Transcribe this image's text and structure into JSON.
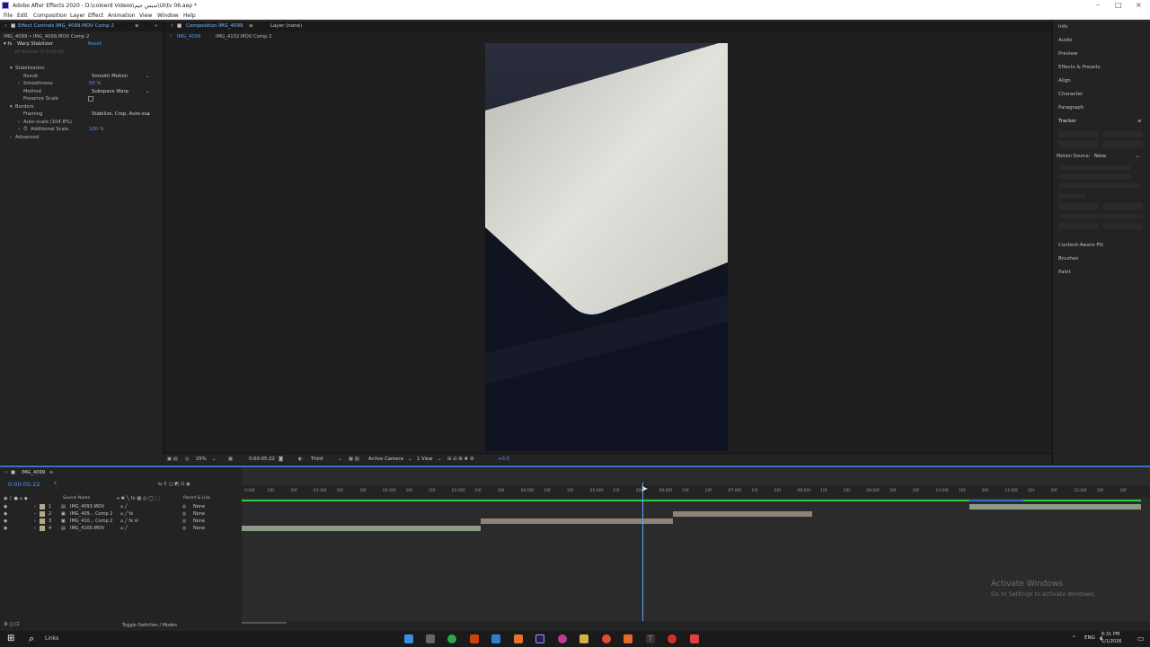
{
  "window": {
    "title": "Adobe After Effects 2020 - D:\\coloerd Videos\\سیس‌ جیم\\UI\\tv 06.aep *"
  },
  "menu": [
    "File",
    "Edit",
    "Composition",
    "Layer",
    "Effect",
    "Animation",
    "View",
    "Window",
    "Help"
  ],
  "effect_controls": {
    "tab_label": "Effect Controls IMG_4099.MOV Comp 2",
    "breadcrumb": "IMG_4099 • IMG_4099.MOV Comp 2",
    "effect_name": "Warp Stabilizer",
    "reset_label": "Reset",
    "dim_status": "All frames in 0.00.00",
    "stabilization_label": "Stabilization",
    "result_label": "Result",
    "result_value": "Smooth Motion",
    "smoothness_label": "Smoothness",
    "smoothness_value": "50 %",
    "method_label": "Method",
    "method_value": "Subspace Warp",
    "preserve_scale_label": "Preserve Scale",
    "borders_label": "Borders",
    "framing_label": "Framing",
    "framing_value": "Stabilize, Crop, Auto-sca",
    "autoscale_label": "Auto-scale (104.8%)",
    "additional_scale_label": "Additional Scale",
    "additional_scale_value": "100 %",
    "advanced_label": "Advanced"
  },
  "composition": {
    "tab_label": "Composition IMG_4099",
    "layer_tab": "Layer (none)",
    "subtab_active": "IMG_4099",
    "subtab_other": "IMG_4102.MOV Comp 2",
    "zoom": "25%",
    "timecode": "0:00:05:22",
    "resolution": "Third",
    "camera": "Active Camera",
    "view": "1 View",
    "exposure": "+0.0"
  },
  "right_panel": {
    "items": [
      "Info",
      "Audio",
      "Preview",
      "Effects & Presets",
      "Align",
      "Character",
      "Paragraph",
      "Tracker"
    ],
    "motion_source_label": "Motion Source:",
    "motion_source_value": "None",
    "bottom_items": [
      "Content-Aware Fill",
      "Brushes",
      "Paint"
    ]
  },
  "timeline": {
    "tab_label": "IMG_4099",
    "timecode": "0:00:05:22",
    "col_source": "Source Name",
    "col_parent": "Parent & Link",
    "layers": [
      {
        "num": "1",
        "name": "IMG_4093.MOV",
        "parent": "None"
      },
      {
        "num": "2",
        "name": "IMG_409... Comp 2",
        "parent": "None"
      },
      {
        "num": "3",
        "name": "IMG_410... Comp 2",
        "parent": "None"
      },
      {
        "num": "4",
        "name": "IMG_4100.MOV",
        "parent": "None"
      }
    ],
    "ticks": [
      "0:00f",
      "10f",
      "20f",
      "01:00f",
      "10f",
      "20f",
      "02:00f",
      "10f",
      "20f",
      "03:00f",
      "10f",
      "20f",
      "04:00f",
      "10f",
      "20f",
      "05:00f",
      "10f",
      "20f",
      "06:00f",
      "10f",
      "20f",
      "07:00f",
      "10f",
      "20f",
      "08:00f",
      "10f",
      "20f",
      "09:00f",
      "10f",
      "20f",
      "10:00f",
      "10f",
      "20f",
      "11:00f",
      "10f",
      "20f",
      "12:00f",
      "10f",
      "20f"
    ],
    "footer_label": "Toggle Switches / Modes"
  },
  "watermark": {
    "title": "Activate Windows",
    "subtitle": "Go to Settings to activate Windows."
  },
  "taskbar": {
    "search_label": "Links",
    "lang": "ENG",
    "time": "6:31 PM",
    "date": "1/1/2026"
  },
  "colors": {
    "accent": "#4c9bff",
    "timeline_border": "#3a6fc7",
    "work_area": "#2ecc40"
  }
}
